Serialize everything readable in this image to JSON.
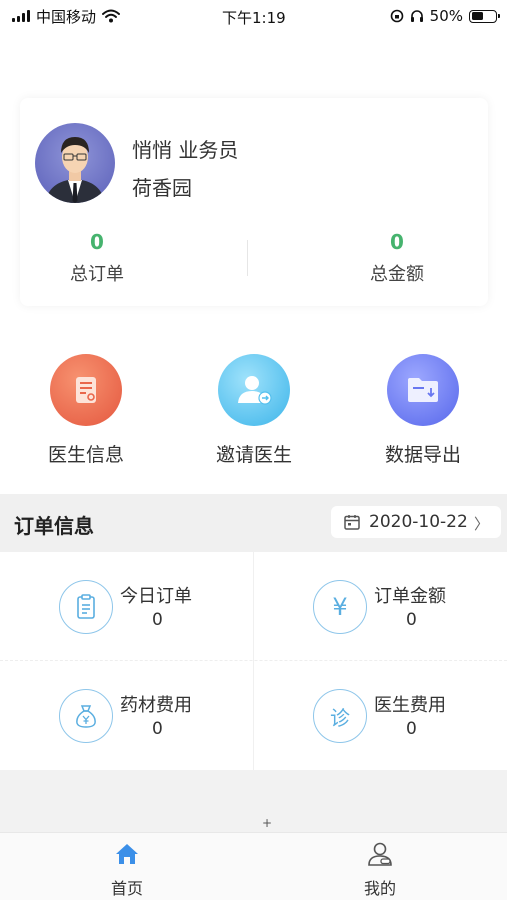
{
  "status_bar": {
    "carrier": "中国移动",
    "time": "下午1:19",
    "battery_text": "50%",
    "battery_level": 0.5,
    "icons": [
      "signal-icon",
      "wifi-icon",
      "orientation-lock-icon",
      "headphones-icon",
      "battery-icon"
    ]
  },
  "profile": {
    "name_line": "悄悄 业务员",
    "store": "荷香园",
    "stats": [
      {
        "value": "0",
        "label": "总订单"
      },
      {
        "value": "0",
        "label": "总金额"
      }
    ],
    "stat_color": "#46b36e"
  },
  "actions": [
    {
      "label": "医生信息",
      "icon": "doctor-info-icon",
      "color": "#e9664b"
    },
    {
      "label": "邀请医生",
      "icon": "invite-doctor-icon",
      "color": "#55c0ee"
    },
    {
      "label": "数据导出",
      "icon": "data-export-icon",
      "color": "#6877f0"
    }
  ],
  "orders": {
    "title": "订单信息",
    "date": "2020-10-22",
    "cells": [
      {
        "title": "今日订单",
        "value": "0",
        "icon": "clipboard-icon"
      },
      {
        "title": "订单金额",
        "value": "0",
        "icon": "yuan-icon"
      },
      {
        "title": "药材费用",
        "value": "0",
        "icon": "money-bag-icon"
      },
      {
        "title": "医生费用",
        "value": "0",
        "icon": "diagnosis-icon"
      }
    ],
    "diag_char": "诊",
    "yuan_char": "¥"
  },
  "tabbar": {
    "items": [
      {
        "label": "首页",
        "icon": "home-icon",
        "active": true,
        "color": "#3b8fe8"
      },
      {
        "label": "我的",
        "icon": "user-icon",
        "active": false
      }
    ]
  }
}
